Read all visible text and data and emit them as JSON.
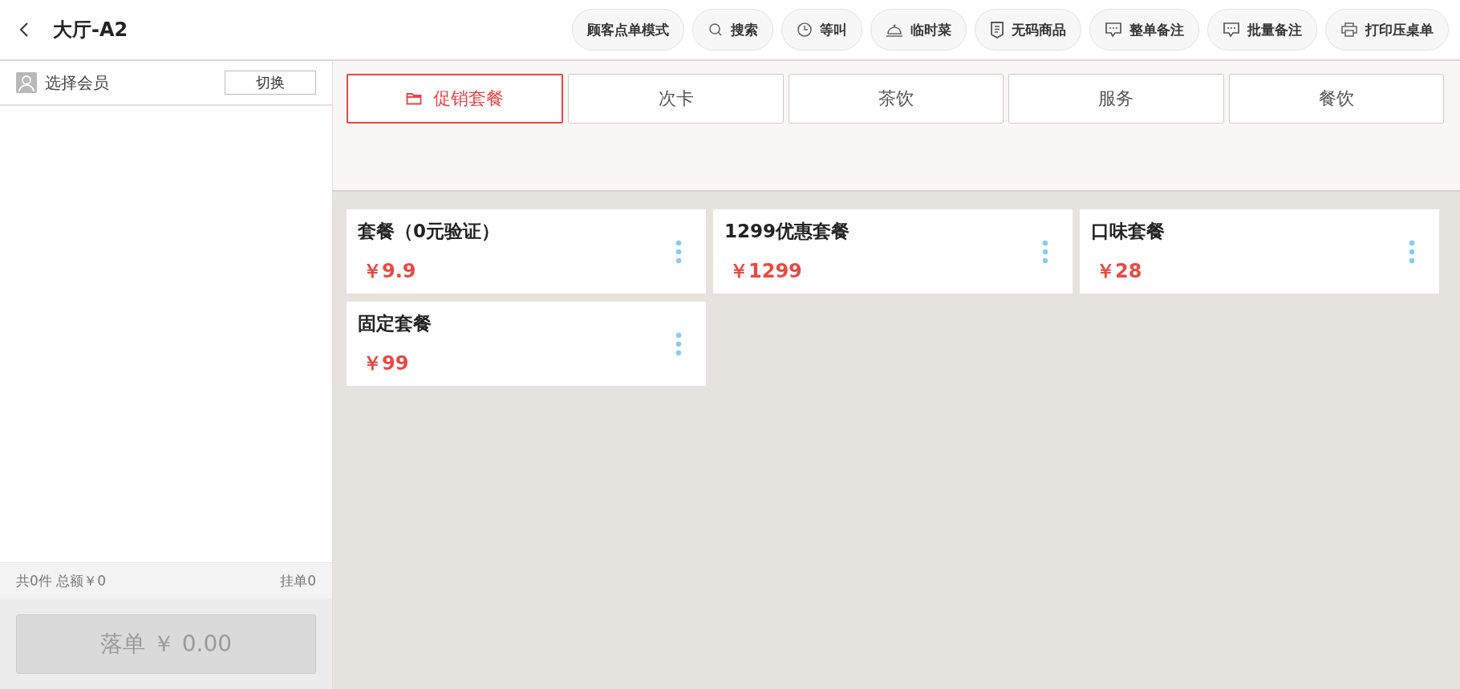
{
  "header": {
    "title": "大厅-A2",
    "actions": [
      {
        "label": "顾客点单模式",
        "kind": "plain"
      },
      {
        "label": "搜索",
        "kind": "search"
      },
      {
        "label": "等叫",
        "kind": "clock"
      },
      {
        "label": "临时菜",
        "kind": "bell"
      },
      {
        "label": "无码商品",
        "kind": "receipt"
      },
      {
        "label": "整单备注",
        "kind": "comment"
      },
      {
        "label": "批量备注",
        "kind": "comment"
      },
      {
        "label": "打印压桌单",
        "kind": "printer"
      }
    ]
  },
  "member": {
    "label": "选择会员",
    "switch_button": "切换"
  },
  "summary": {
    "totals": "共0件 总额￥0",
    "held": "挂单0"
  },
  "submit_button": {
    "label": "落单 ￥ 0.00",
    "disabled": true
  },
  "categories": [
    {
      "label": "促销套餐",
      "selected": true
    },
    {
      "label": "次卡",
      "selected": false
    },
    {
      "label": "茶饮",
      "selected": false
    },
    {
      "label": "服务",
      "selected": false
    },
    {
      "label": "餐饮",
      "selected": false
    }
  ],
  "products": [
    {
      "name": "套餐（0元验证）",
      "price": "￥9.9"
    },
    {
      "name": "1299优惠套餐",
      "price": "￥1299"
    },
    {
      "name": "口味套餐",
      "price": "￥28"
    },
    {
      "name": "固定套餐",
      "price": "￥99"
    }
  ]
}
